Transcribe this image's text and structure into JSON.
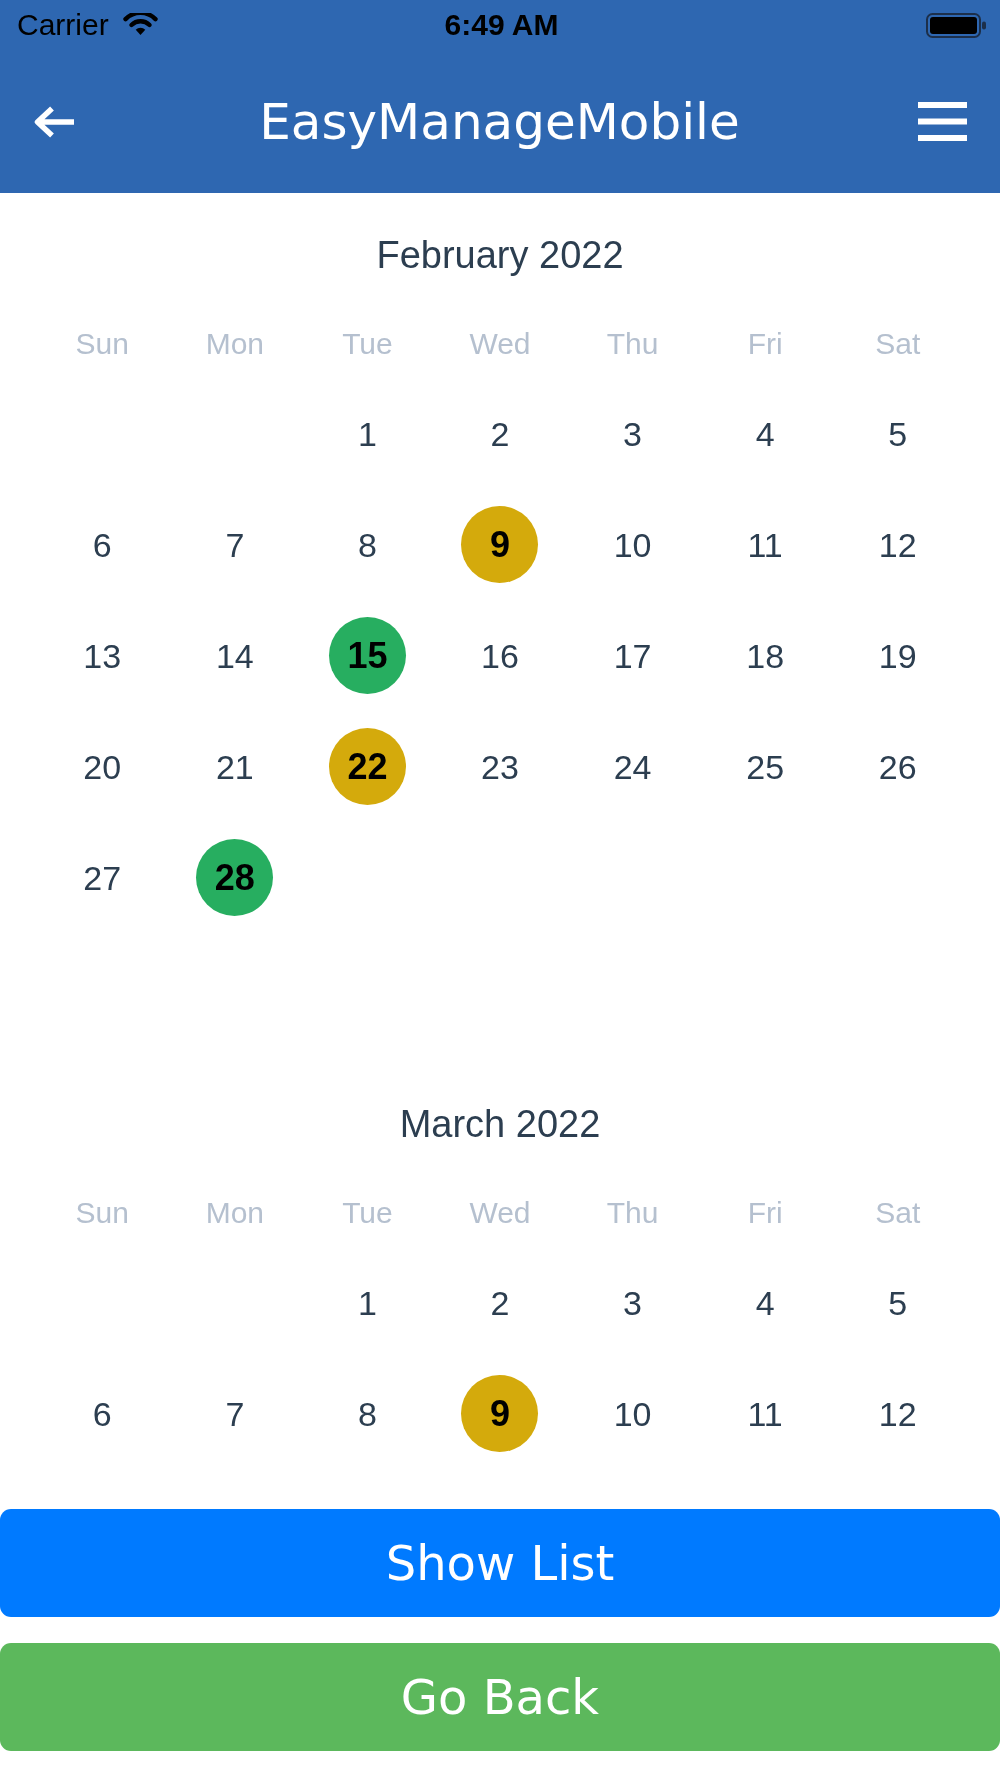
{
  "status_bar": {
    "carrier": "Carrier",
    "time": "6:49 AM"
  },
  "header": {
    "title": "EasyManageMobile"
  },
  "months": [
    {
      "title": "February 2022",
      "weekdays": [
        "Sun",
        "Mon",
        "Tue",
        "Wed",
        "Thu",
        "Fri",
        "Sat"
      ],
      "weeks": [
        {
          "kind": "leading",
          "days": [
            {
              "day": "1"
            },
            {
              "day": "2"
            },
            {
              "day": "3"
            },
            {
              "day": "4"
            },
            {
              "day": "5"
            }
          ]
        },
        {
          "kind": "full",
          "days": [
            {
              "day": "6"
            },
            {
              "day": "7"
            },
            {
              "day": "8"
            },
            {
              "day": "9",
              "color": "#d4aa0c"
            },
            {
              "day": "10"
            },
            {
              "day": "11"
            },
            {
              "day": "12"
            }
          ]
        },
        {
          "kind": "full",
          "days": [
            {
              "day": "13"
            },
            {
              "day": "14"
            },
            {
              "day": "15",
              "color": "#27ae60"
            },
            {
              "day": "16"
            },
            {
              "day": "17"
            },
            {
              "day": "18"
            },
            {
              "day": "19"
            }
          ]
        },
        {
          "kind": "full",
          "days": [
            {
              "day": "20"
            },
            {
              "day": "21"
            },
            {
              "day": "22",
              "color": "#d4aa0c"
            },
            {
              "day": "23"
            },
            {
              "day": "24"
            },
            {
              "day": "25"
            },
            {
              "day": "26"
            }
          ]
        },
        {
          "kind": "trailing",
          "days": [
            {
              "day": "27"
            },
            {
              "day": "28",
              "color": "#27ae60"
            }
          ]
        }
      ]
    },
    {
      "title": "March 2022",
      "weekdays": [
        "Sun",
        "Mon",
        "Tue",
        "Wed",
        "Thu",
        "Fri",
        "Sat"
      ],
      "weeks": [
        {
          "kind": "leading",
          "days": [
            {
              "day": "1"
            },
            {
              "day": "2"
            },
            {
              "day": "3"
            },
            {
              "day": "4"
            },
            {
              "day": "5"
            }
          ]
        },
        {
          "kind": "full",
          "days": [
            {
              "day": "6"
            },
            {
              "day": "7"
            },
            {
              "day": "8"
            },
            {
              "day": "9",
              "color": "#d4aa0c"
            },
            {
              "day": "10"
            },
            {
              "day": "11"
            },
            {
              "day": "12"
            }
          ]
        }
      ]
    }
  ],
  "buttons": [
    {
      "label": "Show List",
      "kind": "primary"
    },
    {
      "label": "Go Back",
      "kind": "success"
    }
  ]
}
